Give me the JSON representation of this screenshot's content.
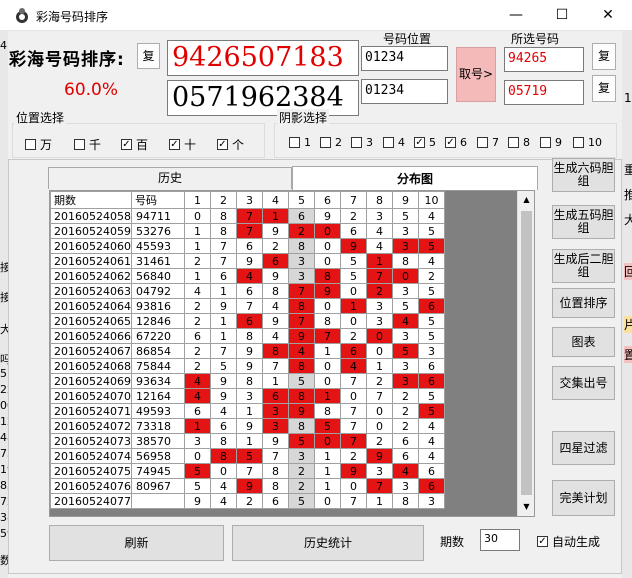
{
  "window": {
    "title": "彩海号码排序",
    "minimize": "—",
    "maximize": "☐",
    "close": "✕"
  },
  "header": {
    "app_label": "彩海号码排序:",
    "copy_btn": "复",
    "main_number_1": "9426507183",
    "main_number_2": "0571962384",
    "percent": "60.0%",
    "position_label": "号码位置",
    "position_1": "01234",
    "position_2": "01234",
    "pick_btn": "取号>",
    "selected_label": "所选号码",
    "selected_1": "94265",
    "selected_2": "05719",
    "copy_btn_2": "复",
    "copy_btn_3": "复"
  },
  "position_group": {
    "label": "位置选择",
    "items": [
      {
        "label": "万",
        "checked": false
      },
      {
        "label": "千",
        "checked": false
      },
      {
        "label": "百",
        "checked": true
      },
      {
        "label": "十",
        "checked": true
      },
      {
        "label": "个",
        "checked": true
      }
    ]
  },
  "yinying_group": {
    "label": "阴影选择",
    "items": [
      {
        "label": "1",
        "checked": false
      },
      {
        "label": "2",
        "checked": false
      },
      {
        "label": "3",
        "checked": false
      },
      {
        "label": "4",
        "checked": false
      },
      {
        "label": "5",
        "checked": true
      },
      {
        "label": "6",
        "checked": true
      },
      {
        "label": "7",
        "checked": false
      },
      {
        "label": "8",
        "checked": false
      },
      {
        "label": "9",
        "checked": false
      },
      {
        "label": "10",
        "checked": false
      }
    ]
  },
  "tabs": {
    "history": "历史",
    "distribution": "分布图"
  },
  "table": {
    "headers": [
      "期数",
      "号码",
      "1",
      "2",
      "3",
      "4",
      "5",
      "6",
      "7",
      "8",
      "9",
      "10"
    ],
    "rows": [
      {
        "period": "20160524058",
        "code": "94711",
        "cells": [
          "0",
          "8",
          "7",
          "1",
          "6",
          "9",
          "2",
          "3",
          "5",
          "4"
        ],
        "red": [
          2,
          3
        ]
      },
      {
        "period": "20160524059",
        "code": "53276",
        "cells": [
          "1",
          "8",
          "7",
          "9",
          "2",
          "0",
          "6",
          "4",
          "3",
          "5"
        ],
        "red": [
          2,
          4,
          5
        ]
      },
      {
        "period": "20160524060",
        "code": "45593",
        "cells": [
          "1",
          "7",
          "6",
          "2",
          "8",
          "0",
          "9",
          "4",
          "3",
          "5"
        ],
        "red": [
          6,
          8,
          9
        ]
      },
      {
        "period": "20160524061",
        "code": "31461",
        "cells": [
          "2",
          "7",
          "9",
          "6",
          "3",
          "0",
          "5",
          "1",
          "8",
          "4"
        ],
        "red": [
          3,
          7
        ]
      },
      {
        "period": "20160524062",
        "code": "56840",
        "cells": [
          "1",
          "6",
          "4",
          "9",
          "3",
          "8",
          "5",
          "7",
          "0",
          "2"
        ],
        "red": [
          2,
          5,
          7,
          8
        ]
      },
      {
        "period": "20160524063",
        "code": "04792",
        "cells": [
          "4",
          "1",
          "6",
          "8",
          "7",
          "9",
          "0",
          "2",
          "3",
          "5"
        ],
        "red": [
          4,
          5,
          7
        ]
      },
      {
        "period": "20160524064",
        "code": "93816",
        "cells": [
          "2",
          "9",
          "7",
          "4",
          "8",
          "0",
          "1",
          "3",
          "5",
          "6"
        ],
        "red": [
          4,
          6,
          9
        ]
      },
      {
        "period": "20160524065",
        "code": "12846",
        "cells": [
          "2",
          "1",
          "6",
          "9",
          "7",
          "8",
          "0",
          "3",
          "4",
          "5"
        ],
        "red": [
          2,
          4,
          8
        ]
      },
      {
        "period": "20160524066",
        "code": "67220",
        "cells": [
          "6",
          "1",
          "8",
          "4",
          "9",
          "7",
          "2",
          "0",
          "3",
          "5"
        ],
        "red": [
          4,
          5,
          7
        ]
      },
      {
        "period": "20160524067",
        "code": "86854",
        "cells": [
          "2",
          "7",
          "9",
          "8",
          "4",
          "1",
          "6",
          "0",
          "5",
          "3"
        ],
        "red": [
          3,
          4,
          6,
          8
        ]
      },
      {
        "period": "20160524068",
        "code": "75844",
        "cells": [
          "2",
          "5",
          "9",
          "7",
          "8",
          "0",
          "4",
          "1",
          "3",
          "6"
        ],
        "red": [
          4,
          6
        ]
      },
      {
        "period": "20160524069",
        "code": "93634",
        "cells": [
          "4",
          "9",
          "8",
          "1",
          "5",
          "0",
          "7",
          "2",
          "3",
          "6"
        ],
        "red": [
          0,
          8,
          9
        ]
      },
      {
        "period": "20160524070",
        "code": "12164",
        "cells": [
          "4",
          "9",
          "3",
          "6",
          "8",
          "1",
          "0",
          "7",
          "2",
          "5"
        ],
        "red": [
          0,
          3,
          4,
          5
        ]
      },
      {
        "period": "20160524071",
        "code": "49593",
        "cells": [
          "6",
          "4",
          "1",
          "3",
          "9",
          "8",
          "7",
          "0",
          "2",
          "5"
        ],
        "red": [
          3,
          4,
          9
        ]
      },
      {
        "period": "20160524072",
        "code": "73318",
        "cells": [
          "1",
          "6",
          "9",
          "3",
          "8",
          "5",
          "7",
          "0",
          "2",
          "4"
        ],
        "red": [
          0,
          3,
          5
        ]
      },
      {
        "period": "20160524073",
        "code": "38570",
        "cells": [
          "3",
          "8",
          "1",
          "9",
          "5",
          "0",
          "7",
          "2",
          "6",
          "4"
        ],
        "red": [
          4,
          5,
          6
        ]
      },
      {
        "period": "20160524074",
        "code": "56958",
        "cells": [
          "0",
          "8",
          "5",
          "7",
          "3",
          "1",
          "2",
          "9",
          "6",
          "4"
        ],
        "red": [
          1,
          2,
          7
        ]
      },
      {
        "period": "20160524075",
        "code": "74945",
        "cells": [
          "5",
          "0",
          "7",
          "8",
          "2",
          "1",
          "9",
          "3",
          "4",
          "6"
        ],
        "red": [
          0,
          6,
          8
        ]
      },
      {
        "period": "20160524076",
        "code": "80967",
        "cells": [
          "5",
          "4",
          "9",
          "8",
          "2",
          "1",
          "0",
          "7",
          "3",
          "6"
        ],
        "red": [
          2,
          7,
          9
        ]
      },
      {
        "period": "20160524077",
        "code": "",
        "cells": [
          "9",
          "4",
          "2",
          "6",
          "5",
          "0",
          "7",
          "1",
          "8",
          "3"
        ],
        "red": []
      }
    ]
  },
  "right_buttons": [
    "生成六码胆组",
    "生成五码胆组",
    "生成后二胆组",
    "位置排序",
    "图表",
    "交集出号",
    "四星过滤",
    "完美计划"
  ],
  "bottom": {
    "refresh": "刷新",
    "history_stats": "历史统计",
    "period_label": "期数",
    "period_value": "30",
    "auto_gen": "自动生成",
    "auto_checked": true
  },
  "colors": {
    "red_cell": "#e41414",
    "number_red": "#e00000",
    "pick_btn": "#f4b9b9",
    "shade_col": "#d7d7d7"
  },
  "left_edge_fragments": [
    "4",
    "接",
    "接",
    "大",
    "吗",
    "5)",
    "22",
    "00",
    "12",
    "48",
    "75",
    "19",
    "83",
    "72",
    "38",
    "59",
    "数",
    "5"
  ],
  "right_edge_fragments": [
    "1",
    "重",
    "推",
    "大",
    "回",
    "片",
    "置"
  ]
}
